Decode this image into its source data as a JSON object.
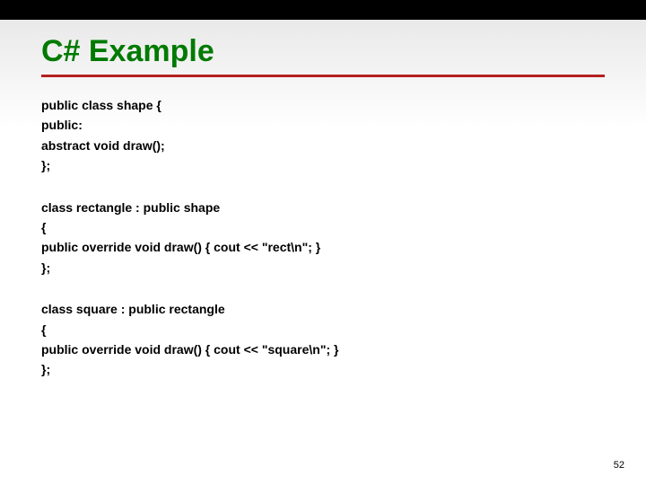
{
  "title": "C# Example",
  "blocks": [
    {
      "lines": [
        "public class shape {",
        "public:",
        "abstract void draw();",
        "};"
      ]
    },
    {
      "lines": [
        "class rectangle : public shape",
        "{",
        "public override void draw() { cout << \"rect\\n\"; }",
        "};"
      ]
    },
    {
      "lines": [
        "class square : public rectangle",
        "{",
        "public override void draw() { cout << \"square\\n\"; }",
        "};"
      ]
    }
  ],
  "page_number": "52"
}
